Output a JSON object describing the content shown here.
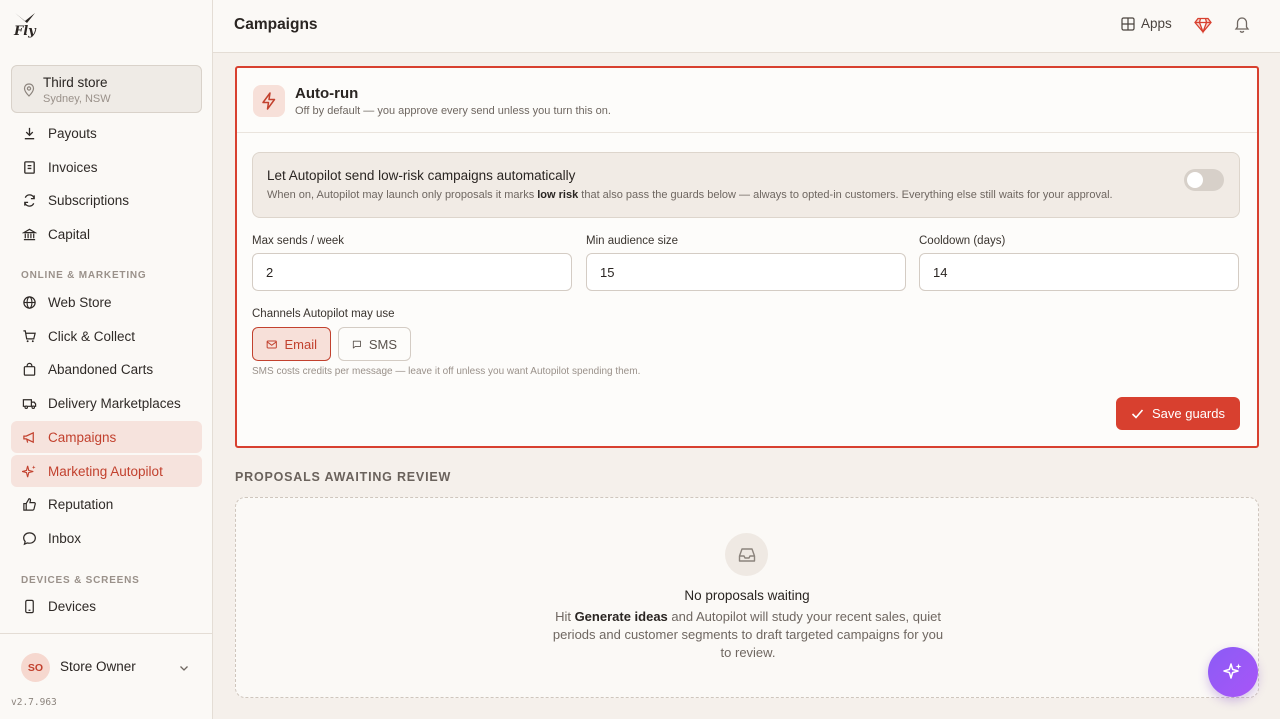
{
  "app": {
    "logo_text": "Fly",
    "version": "v2.7.963"
  },
  "store": {
    "name": "Third store",
    "location": "Sydney, NSW"
  },
  "nav": {
    "items_top": [
      {
        "label": "Payouts",
        "icon": "download-icon"
      },
      {
        "label": "Invoices",
        "icon": "receipt-icon"
      },
      {
        "label": "Subscriptions",
        "icon": "refresh-icon"
      },
      {
        "label": "Capital",
        "icon": "bank-icon"
      }
    ],
    "section_online": "ONLINE & MARKETING",
    "items_online": [
      {
        "label": "Web Store",
        "icon": "globe-icon"
      },
      {
        "label": "Click & Collect",
        "icon": "cart-icon"
      },
      {
        "label": "Abandoned Carts",
        "icon": "bag-icon"
      },
      {
        "label": "Delivery Marketplaces",
        "icon": "truck-icon"
      },
      {
        "label": "Campaigns",
        "icon": "megaphone-icon"
      },
      {
        "label": "Marketing Autopilot",
        "icon": "sparkle-icon"
      },
      {
        "label": "Reputation",
        "icon": "thumbs-up-icon"
      },
      {
        "label": "Inbox",
        "icon": "chat-icon"
      }
    ],
    "section_devices": "DEVICES & SCREENS",
    "items_devices": [
      {
        "label": "Devices",
        "icon": "phone-icon"
      }
    ]
  },
  "user": {
    "initials": "SO",
    "name": "Store Owner"
  },
  "header": {
    "title": "Campaigns",
    "apps_label": "Apps"
  },
  "autorun": {
    "title": "Auto-run",
    "subtitle": "Off by default — you approve every send unless you turn this on.",
    "toggle_title": "Let Autopilot send low-risk campaigns automatically",
    "toggle_desc_pre": "When on, Autopilot may launch only proposals it marks ",
    "toggle_desc_bold": "low risk",
    "toggle_desc_post": " that also pass the guards below — always to opted-in customers. Everything else still waits for your approval.",
    "toggle_on": false,
    "fields": [
      {
        "label": "Max sends / week",
        "value": "2"
      },
      {
        "label": "Min audience size",
        "value": "15"
      },
      {
        "label": "Cooldown (days)",
        "value": "14"
      }
    ],
    "channels_label": "Channels Autopilot may use",
    "channel_email": "Email",
    "channel_sms": "SMS",
    "sms_note": "SMS costs credits per message — leave it off unless you want Autopilot spending them.",
    "save_label": "Save guards"
  },
  "proposals": {
    "section_title": "PROPOSALS AWAITING REVIEW",
    "empty_title": "No proposals waiting",
    "empty_pre": "Hit ",
    "empty_bold": "Generate ideas",
    "empty_post": " and Autopilot will study your recent sales, quiet periods and customer segments to draft targeted campaigns for you to review."
  },
  "colors": {
    "accent": "#d8402f",
    "active_bg": "#f6e3dd",
    "fab": "#9b5cf6"
  }
}
